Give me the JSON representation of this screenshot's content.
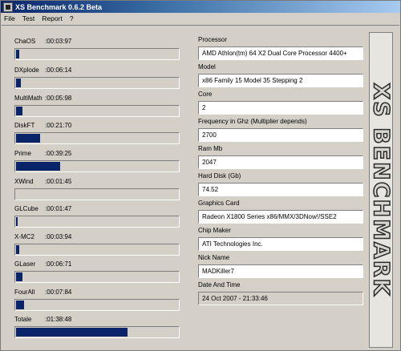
{
  "window": {
    "title": "XS Benchmark 0.6.2 Beta"
  },
  "menu": [
    "File",
    "Test",
    "Report",
    "?"
  ],
  "benchmarks": [
    {
      "name": "ChaOS",
      "time": "00:03:97",
      "progress": 0.02
    },
    {
      "name": "DXplode",
      "time": "00:06:14",
      "progress": 0.03
    },
    {
      "name": "MultiMath",
      "time": "00:05:98",
      "progress": 0.04
    },
    {
      "name": "DiskFT",
      "time": "00:21:70",
      "progress": 0.15
    },
    {
      "name": "Prime",
      "time": "00:39:25",
      "progress": 0.27
    },
    {
      "name": "XWind",
      "time": "00:01:45",
      "progress": 0.0
    },
    {
      "name": "GLCube",
      "time": "00:01:47",
      "progress": 0.01
    },
    {
      "name": "X-MC2",
      "time": "00:03:94",
      "progress": 0.02
    },
    {
      "name": "GLaser",
      "time": "00:06:71",
      "progress": 0.04
    },
    {
      "name": "FourAll",
      "time": "00:07:84",
      "progress": 0.05
    },
    {
      "name": "Totale",
      "time": "01:38:48",
      "progress": 0.69
    }
  ],
  "info": [
    {
      "label": "Processor",
      "value": "AMD Athlon(tm) 64 X2 Dual Core Processor 4400+",
      "readonly": false
    },
    {
      "label": "Model",
      "value": "x86 Family 15 Model 35 Stepping 2",
      "readonly": false
    },
    {
      "label": "Core",
      "value": "2",
      "readonly": false
    },
    {
      "label": "Frequency in Ghz (Multiplier depends)",
      "value": "2700",
      "readonly": false
    },
    {
      "label": "Ram Mb",
      "value": "2047",
      "readonly": false
    },
    {
      "label": "Hard Disk (Gb)",
      "value": "74.52",
      "readonly": false
    },
    {
      "label": "Graphics Card",
      "value": "Radeon X1800 Series x86/MMX/3DNow!/SSE2",
      "readonly": false
    },
    {
      "label": "Chip Maker",
      "value": "ATI Technologies Inc.",
      "readonly": false
    },
    {
      "label": "Nick Name",
      "value": "MADKiller7",
      "readonly": false
    },
    {
      "label": "Date And Time",
      "value": "24 Oct 2007  -  21:33:46",
      "readonly": true
    }
  ],
  "logo": {
    "text": "XS BENCHMARK",
    "icon": "xs-benchmark-logo"
  }
}
